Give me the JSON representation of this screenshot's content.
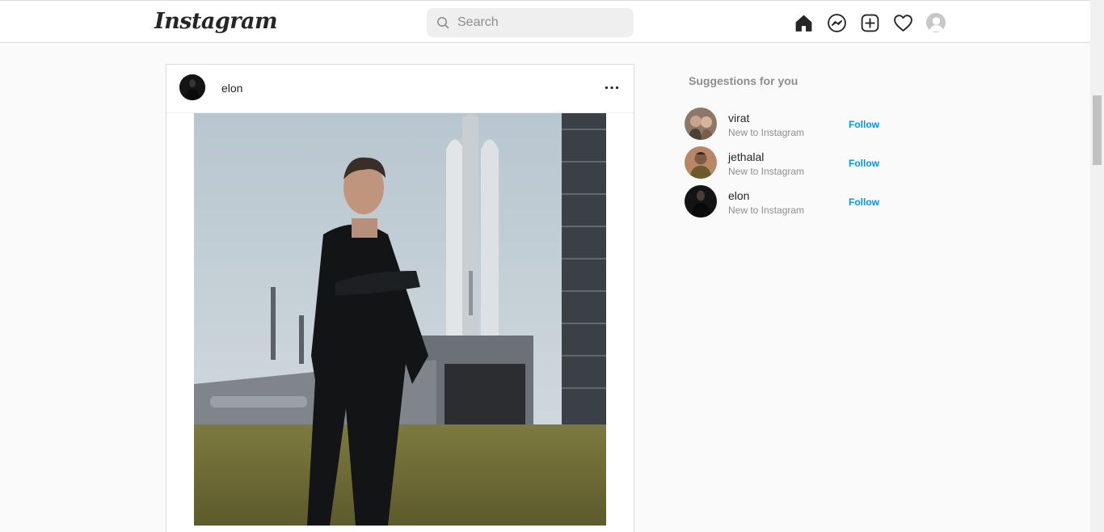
{
  "app": {
    "logo_text": "Instagram"
  },
  "search": {
    "placeholder": "Search"
  },
  "nav": {
    "icons": [
      "home-icon",
      "messenger-icon",
      "new-post-icon",
      "activity-heart-icon",
      "profile-avatar"
    ]
  },
  "post": {
    "username": "elon",
    "more_icon": "more-options-icon"
  },
  "suggestions": {
    "title": "Suggestions for you",
    "items": [
      {
        "name": "virat",
        "subtitle": "New to Instagram",
        "action": "Follow"
      },
      {
        "name": "jethalal",
        "subtitle": "New to Instagram",
        "action": "Follow"
      },
      {
        "name": "elon",
        "subtitle": "New to Instagram",
        "action": "Follow"
      }
    ]
  },
  "colors": {
    "accent": "#0095f6",
    "border": "#dbdbdb",
    "background": "#fafafa",
    "muted": "#8e8e8e"
  }
}
